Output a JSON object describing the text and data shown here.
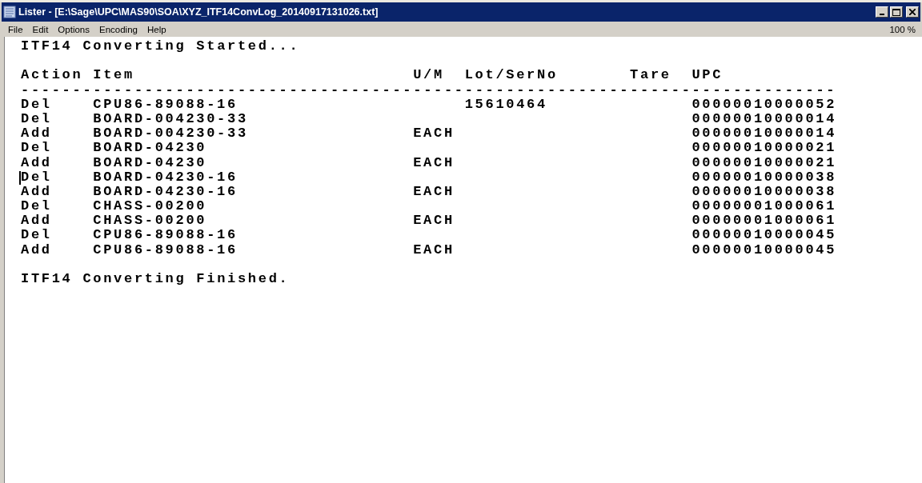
{
  "window": {
    "title": "Lister - [E:\\Sage\\UPC\\MAS90\\SOA\\XYZ_ITF14ConvLog_20140917131026.txt]"
  },
  "menu": [
    "File",
    "Edit",
    "Options",
    "Encoding",
    "Help"
  ],
  "zoom": "100 %",
  "document": {
    "intro": "ITF14 Converting Started...",
    "columns": [
      "Action",
      "Item",
      "U/M",
      "Lot/SerNo",
      "Tare",
      "UPC"
    ],
    "separator": "-------------------------------------------------------------------------------",
    "rows": [
      {
        "action": "Del",
        "item": "CPU86-89088-16",
        "lot": "15610464",
        "upc": "00000010000052",
        "caret": false
      },
      {
        "action": "Del",
        "item": "BOARD-004230-33",
        "upc": "00000010000014",
        "caret": false
      },
      {
        "action": "Add",
        "item": "BOARD-004230-33",
        "um": "EACH",
        "upc": "00000010000014",
        "caret": false
      },
      {
        "action": "Del",
        "item": "BOARD-04230",
        "upc": "00000010000021",
        "caret": false
      },
      {
        "action": "Add",
        "item": "BOARD-04230",
        "um": "EACH",
        "upc": "00000010000021",
        "caret": false
      },
      {
        "action": "Del",
        "item": "BOARD-04230-16",
        "upc": "00000010000038",
        "caret": true
      },
      {
        "action": "Add",
        "item": "BOARD-04230-16",
        "um": "EACH",
        "upc": "00000010000038",
        "caret": false
      },
      {
        "action": "Del",
        "item": "CHASS-00200",
        "upc": "00000001000061",
        "caret": false
      },
      {
        "action": "Add",
        "item": "CHASS-00200",
        "um": "EACH",
        "upc": "00000001000061",
        "caret": false
      },
      {
        "action": "Del",
        "item": "CPU86-89088-16",
        "upc": "00000010000045",
        "caret": false
      },
      {
        "action": "Add",
        "item": "CPU86-89088-16",
        "um": "EACH",
        "upc": "00000010000045",
        "caret": false
      }
    ],
    "outro": "ITF14 Converting Finished."
  }
}
